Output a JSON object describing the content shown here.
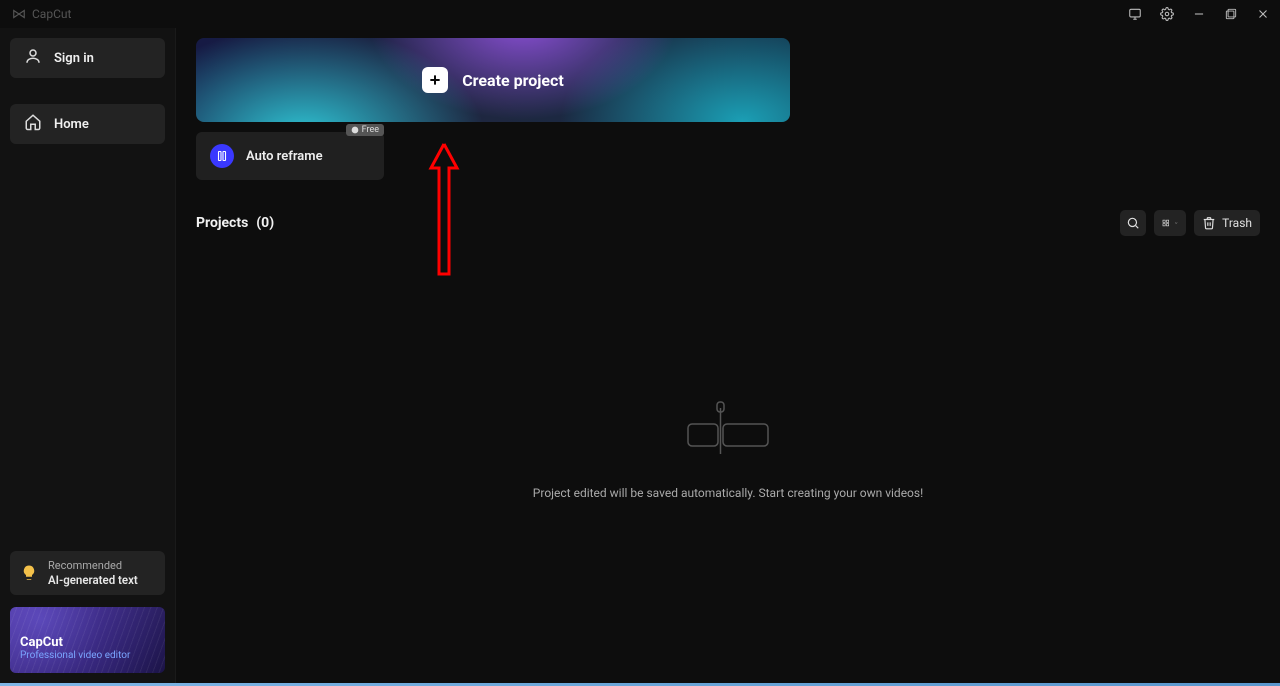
{
  "app": {
    "name": "CapCut"
  },
  "sidebar": {
    "sign_in": "Sign in",
    "home": "Home",
    "promo": {
      "top": "Recommended",
      "bottom": "AI-generated text"
    },
    "banner": {
      "title": "CapCut",
      "subtitle": "Professional video editor"
    }
  },
  "main": {
    "create_label": "Create project",
    "chips": {
      "auto_reframe": "Auto reframe",
      "auto_reframe_badge": "Free"
    },
    "projects": {
      "title": "Projects",
      "count": "(0)"
    },
    "toolbar": {
      "trash": "Trash"
    },
    "empty_text": "Project edited will be saved automatically. Start creating your own videos!"
  }
}
